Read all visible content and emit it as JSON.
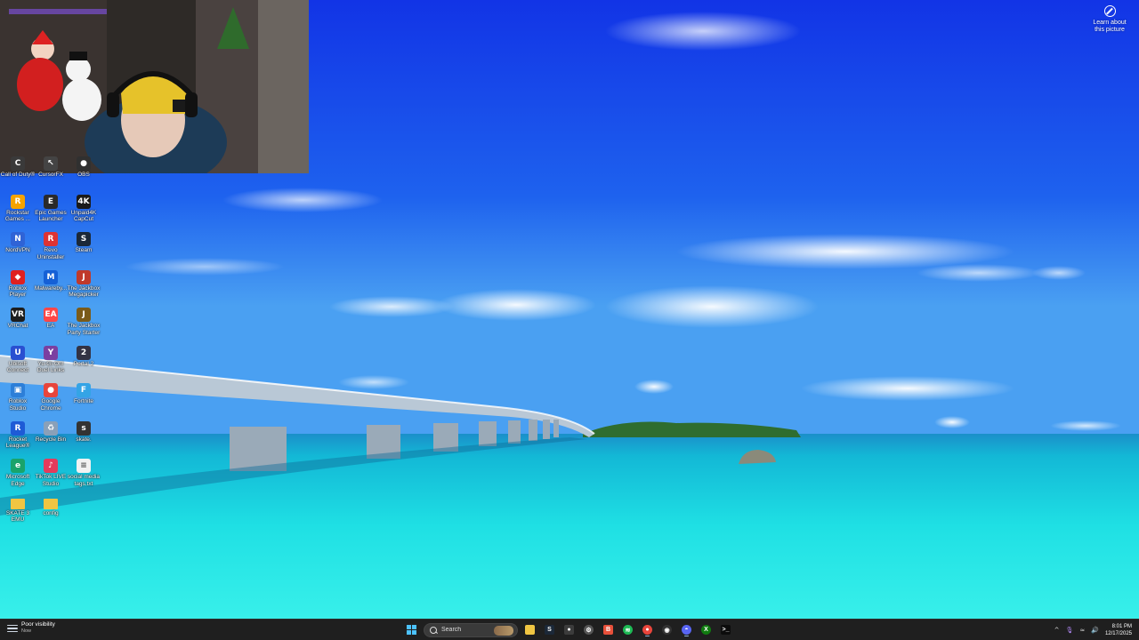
{
  "learn_about": {
    "line1": "Learn about",
    "line2": "this picture"
  },
  "desktop_icons": [
    {
      "id": "call-of-duty",
      "label": "Call of Duty®",
      "icon": "cod-icon",
      "color": "#3a3a3a",
      "glyph": "C"
    },
    {
      "id": "cursorfx",
      "label": "CursorFX",
      "icon": "cursor-icon",
      "color": "#444",
      "glyph": "↖"
    },
    {
      "id": "obs",
      "label": "OBS",
      "icon": "obs-icon",
      "color": "#303030",
      "glyph": "●"
    },
    {
      "id": "rockstar",
      "label": "Rockstar Games ...",
      "icon": "rockstar-icon",
      "color": "#f5a300",
      "glyph": "R"
    },
    {
      "id": "epic",
      "label": "Epic Games Launcher",
      "icon": "epic-icon",
      "color": "#2a2a2a",
      "glyph": "E"
    },
    {
      "id": "capcut",
      "label": "Unpaid4K CapCut",
      "icon": "capcut-icon",
      "color": "#1a1a1a",
      "glyph": "4K"
    },
    {
      "id": "nordvpn",
      "label": "NordVPN",
      "icon": "nordvpn-icon",
      "color": "#2f63d6",
      "glyph": "N"
    },
    {
      "id": "revo",
      "label": "Revo Uninstaller",
      "icon": "revo-icon",
      "color": "#d33",
      "glyph": "R"
    },
    {
      "id": "steam",
      "label": "Steam",
      "icon": "steam-icon",
      "color": "#1b2838",
      "glyph": "S"
    },
    {
      "id": "roblox-player",
      "label": "Roblox Player",
      "icon": "roblox-icon",
      "color": "#e02020",
      "glyph": "◆"
    },
    {
      "id": "malwarebytes",
      "label": "Malwareby...",
      "icon": "malwarebytes-icon",
      "color": "#1560d6",
      "glyph": "M"
    },
    {
      "id": "jackbox-mega",
      "label": "The Jackbox Megapicker",
      "icon": "jackbox-icon",
      "color": "#c0392b",
      "glyph": "J"
    },
    {
      "id": "vrchat",
      "label": "VRChat",
      "icon": "vrchat-icon",
      "color": "#1d1d1d",
      "glyph": "VR"
    },
    {
      "id": "ea",
      "label": "EA",
      "icon": "ea-icon",
      "color": "#ff4747",
      "glyph": "EA"
    },
    {
      "id": "jackbox-starter",
      "label": "The Jackbox Party Starter",
      "icon": "jackbox-icon",
      "color": "#7a5b1a",
      "glyph": "J"
    },
    {
      "id": "ubisoft",
      "label": "Ubisoft Connect",
      "icon": "ubisoft-icon",
      "color": "#2a4fd1",
      "glyph": "U"
    },
    {
      "id": "yugioh",
      "label": "Yu-Gi-Oh! Duel Links",
      "icon": "yugioh-icon",
      "color": "#7b3fa0",
      "glyph": "Y"
    },
    {
      "id": "portal2",
      "label": "Portal 2",
      "icon": "portal-icon",
      "color": "#334",
      "glyph": "2"
    },
    {
      "id": "roblox-studio",
      "label": "Roblox Studio",
      "icon": "roblox-studio-icon",
      "color": "#2d7fd8",
      "glyph": "▣"
    },
    {
      "id": "chrome",
      "label": "Google Chrome",
      "icon": "chrome-icon",
      "color": "#e8453c",
      "glyph": "●"
    },
    {
      "id": "fortnite",
      "label": "Fortnite",
      "icon": "fortnite-icon",
      "color": "#34a4e6",
      "glyph": "F"
    },
    {
      "id": "rocket-league",
      "label": "Rocket League®",
      "icon": "rocket-league-icon",
      "color": "#1e5bd6",
      "glyph": "R"
    },
    {
      "id": "recycle-bin",
      "label": "Recycle Bin",
      "icon": "recycle-bin-icon",
      "color": "#8aa0b8",
      "glyph": "♻"
    },
    {
      "id": "skate",
      "label": "skate.",
      "icon": "skate-icon",
      "color": "#333",
      "glyph": "s"
    },
    {
      "id": "edge",
      "label": "Microsoft Edge",
      "icon": "edge-icon",
      "color": "#1aa36b",
      "glyph": "e"
    },
    {
      "id": "tiktok-live",
      "label": "TikTok LIVE Studio",
      "icon": "tiktok-icon",
      "color": "#e33b5c",
      "glyph": "♪"
    },
    {
      "id": "social-media",
      "label": "social media tags.txt",
      "icon": "text-file-icon",
      "color": "#f2f2f2",
      "glyph": "≡"
    },
    {
      "id": "skate3-emu",
      "label": "SKATE 3 EMU",
      "icon": "folder-icon",
      "color": "#f0c542",
      "glyph": ""
    },
    {
      "id": "config",
      "label": "config",
      "icon": "folder-icon",
      "color": "#f0c542",
      "glyph": ""
    }
  ],
  "taskbar": {
    "weather": {
      "title": "Poor visibility",
      "subtitle": "Now",
      "icon": "fog-icon"
    },
    "search_placeholder": "Search",
    "apps": [
      {
        "id": "file-explorer",
        "icon": "folder-icon",
        "color": "#f0c542",
        "glyph": "",
        "active": false
      },
      {
        "id": "steam",
        "icon": "steam-icon",
        "color": "#1b2838",
        "glyph": "S",
        "active": false
      },
      {
        "id": "obs",
        "icon": "obs-icon",
        "color": "#3c3c3c",
        "glyph": "●",
        "active": false
      },
      {
        "id": "settings",
        "icon": "gear-icon",
        "color": "#555",
        "glyph": "⚙",
        "active": false
      },
      {
        "id": "brave",
        "icon": "brave-icon",
        "color": "#e8503a",
        "glyph": "B",
        "active": false
      },
      {
        "id": "spotify",
        "icon": "spotify-icon",
        "color": "#1db954",
        "glyph": "≋",
        "active": false
      },
      {
        "id": "chrome",
        "icon": "chrome-icon",
        "color": "#e8453c",
        "glyph": "●",
        "active": true
      },
      {
        "id": "github",
        "icon": "github-icon",
        "color": "#333",
        "glyph": "◉",
        "active": false
      },
      {
        "id": "discord",
        "icon": "discord-icon",
        "color": "#5865f2",
        "glyph": "◓",
        "active": true
      },
      {
        "id": "xbox",
        "icon": "xbox-icon",
        "color": "#107c10",
        "glyph": "X",
        "active": false
      },
      {
        "id": "terminal",
        "icon": "terminal-icon",
        "color": "#0c0c0c",
        "glyph": ">_",
        "active": false
      }
    ],
    "tray": {
      "chevron": "^",
      "mic": "🎙",
      "wifi": "≈",
      "volume": "🔊",
      "time": "8:01 PM",
      "date": "12/17/2025"
    }
  }
}
